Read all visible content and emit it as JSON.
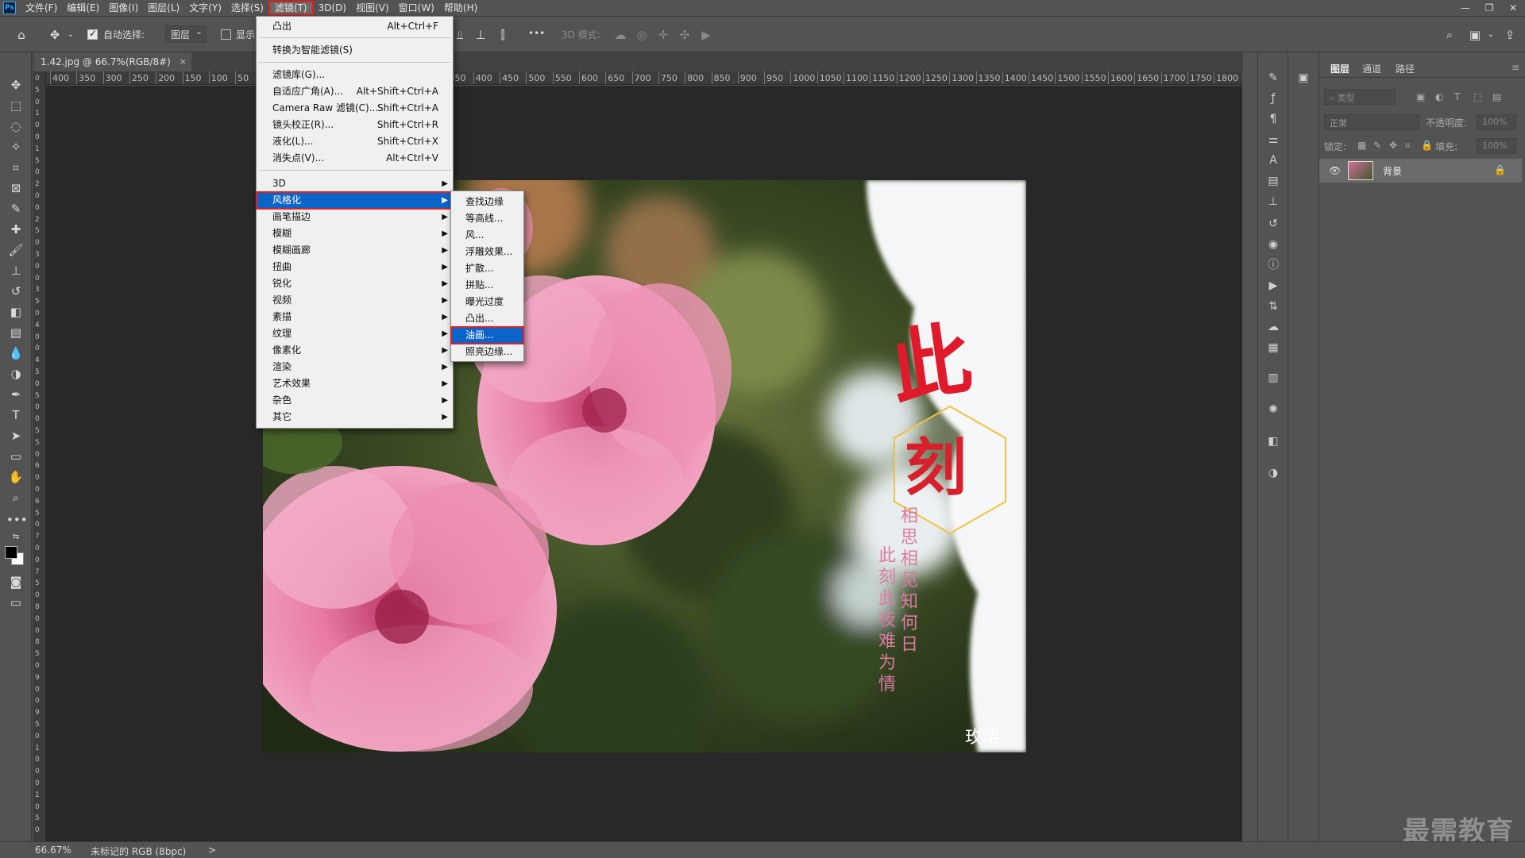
{
  "menubar": {
    "app_logo": "Ps",
    "items": [
      "文件(F)",
      "编辑(E)",
      "图像(I)",
      "图层(L)",
      "文字(Y)",
      "选择(S)",
      "滤镜(T)",
      "3D(D)",
      "视图(V)",
      "窗口(W)",
      "帮助(H)"
    ],
    "active_index": 6,
    "window_controls": [
      "—",
      "❐",
      "✕"
    ]
  },
  "options": {
    "auto_select_label": "自动选择:",
    "auto_select_target": "图层",
    "show_label": "显示",
    "mode_3d_label": "3D 模式:",
    "more": "•••"
  },
  "document": {
    "tab_title": "1.42.jpg @ 66.7%(RGB/8#)",
    "tab_close": "×",
    "ruler_labels": [
      "400",
      "350",
      "300",
      "250",
      "200",
      "150",
      "100",
      "50",
      "0",
      "50",
      "100",
      "150",
      "200",
      "250",
      "300",
      "350",
      "400",
      "450",
      "500",
      "550",
      "600",
      "650",
      "700",
      "750",
      "800",
      "850",
      "900",
      "950",
      "1000",
      "1050",
      "1100",
      "1150",
      "1200",
      "1250",
      "1300",
      "1350",
      "1400",
      "1450",
      "1500",
      "1550",
      "1600",
      "1650",
      "1700",
      "1750",
      "1800"
    ],
    "ruler_left_labels": [
      "0",
      "5",
      "0",
      "1",
      "0",
      "0",
      "1",
      "5",
      "0",
      "2",
      "0",
      "0",
      "2",
      "5",
      "0",
      "3",
      "0",
      "0",
      "3",
      "5",
      "0",
      "4",
      "0",
      "0",
      "4",
      "5",
      "0",
      "5",
      "0",
      "0",
      "5",
      "5",
      "0",
      "6",
      "0",
      "0",
      "6",
      "5",
      "0",
      "7",
      "0",
      "0",
      "7",
      "5",
      "0",
      "8",
      "0",
      "0",
      "8",
      "5",
      "0",
      "9",
      "0",
      "0",
      "9",
      "5",
      "0",
      "1",
      "0",
      "0",
      "0",
      "1",
      "0",
      "5",
      "0"
    ]
  },
  "artwork": {
    "big_char_1": "此",
    "big_char_2": "刻",
    "poem_col_1": "相思相见知何日",
    "poem_col_2": "此刻此夜难为情",
    "signature": "玫珺"
  },
  "filter_menu": {
    "items": [
      {
        "label": "凸出",
        "shortcut": "Alt+Ctrl+F"
      },
      {
        "label": "转换为智能滤镜(S)",
        "shortcut": ""
      },
      {
        "label": "滤镜库(G)...",
        "shortcut": ""
      },
      {
        "label": "自适应广角(A)...",
        "shortcut": "Alt+Shift+Ctrl+A"
      },
      {
        "label": "Camera Raw 滤镜(C)...",
        "shortcut": "Shift+Ctrl+A"
      },
      {
        "label": "镜头校正(R)...",
        "shortcut": "Shift+Ctrl+R"
      },
      {
        "label": "液化(L)...",
        "shortcut": "Shift+Ctrl+X"
      },
      {
        "label": "消失点(V)...",
        "shortcut": "Alt+Ctrl+V"
      }
    ],
    "submenus": [
      "3D",
      "风格化",
      "画笔描边",
      "模糊",
      "模糊画廊",
      "扭曲",
      "锐化",
      "视频",
      "素描",
      "纹理",
      "像素化",
      "渲染",
      "艺术效果",
      "杂色",
      "其它"
    ],
    "submenu_highlight_index": 1
  },
  "stylize_menu": {
    "items": [
      "查找边缘",
      "等高线...",
      "风...",
      "浮雕效果...",
      "扩散...",
      "拼贴...",
      "曝光过度",
      "凸出...",
      "油画...",
      "照亮边缘..."
    ],
    "highlight_index": 8
  },
  "layers_panel": {
    "tabs": [
      "图层",
      "通道",
      "路径"
    ],
    "active_tab": 0,
    "filter_placeholder": "类型",
    "blend_mode": "正常",
    "opacity_label": "不透明度:",
    "opacity_value": "100%",
    "lock_label": "锁定:",
    "fill_label": "填充:",
    "fill_value": "100%",
    "layer_name": "背景"
  },
  "status": {
    "zoom": "66.67%",
    "profile": "未标记的 RGB (8bpc)",
    "arrow": ">"
  },
  "watermark": "最需教育",
  "colors": {
    "ui_bg": "#535353",
    "canvas_bg": "#282828",
    "menu_highlight": "#0b64c8",
    "annotation_red": "#e02020",
    "poem_pink": "#d97aa0"
  }
}
